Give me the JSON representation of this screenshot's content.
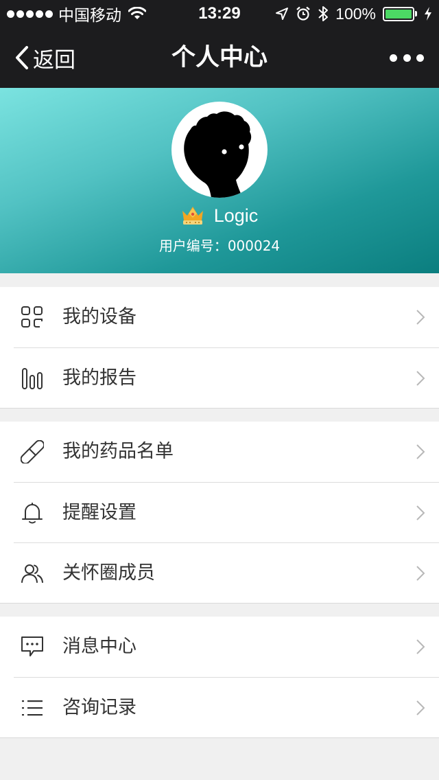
{
  "status_bar": {
    "carrier": "中国移动",
    "time": "13:29",
    "battery": "100%",
    "battery_level": 1.0
  },
  "nav": {
    "back_label": "返回",
    "title": "个人中心"
  },
  "profile": {
    "username": "Logic",
    "user_id_label": "用户编号：",
    "user_id": "000024"
  },
  "menu": {
    "group1": [
      {
        "label": "我的设备",
        "icon": "devices-grid-icon"
      },
      {
        "label": "我的报告",
        "icon": "bar-chart-icon"
      }
    ],
    "group2": [
      {
        "label": "我的药品名单",
        "icon": "pill-icon"
      },
      {
        "label": "提醒设置",
        "icon": "bell-icon"
      },
      {
        "label": "关怀圈成员",
        "icon": "members-icon"
      }
    ],
    "group3": [
      {
        "label": "消息中心",
        "icon": "message-icon"
      },
      {
        "label": "咨询记录",
        "icon": "list-icon"
      }
    ]
  },
  "colors": {
    "bar_bg": "#1c1c1e",
    "header_gradient_start": "#7be3e0",
    "header_gradient_end": "#0b7e7f",
    "battery_fill": "#4cd964",
    "page_bg": "#f0f0f0"
  }
}
